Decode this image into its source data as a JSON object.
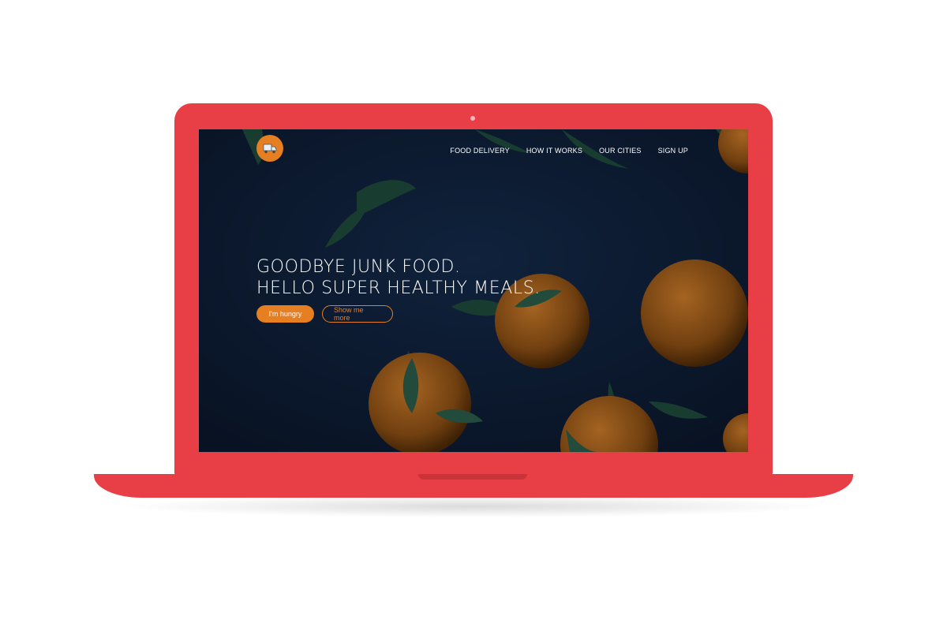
{
  "brand": {
    "logo_icon": "delivery-truck-icon",
    "accent": "#e67e22",
    "device_color": "#e83f47"
  },
  "nav": {
    "items": [
      {
        "label": "FOOD DELIVERY"
      },
      {
        "label": "HOW IT WORKS"
      },
      {
        "label": "OUR CITIES"
      },
      {
        "label": "SIGN UP"
      }
    ]
  },
  "hero": {
    "line1": "GOODBYE JUNK FOOD.",
    "line2": "HELLO SUPER HEALTHY MEALS.",
    "primary_button": "I'm hungry",
    "secondary_button": "Show me more"
  }
}
